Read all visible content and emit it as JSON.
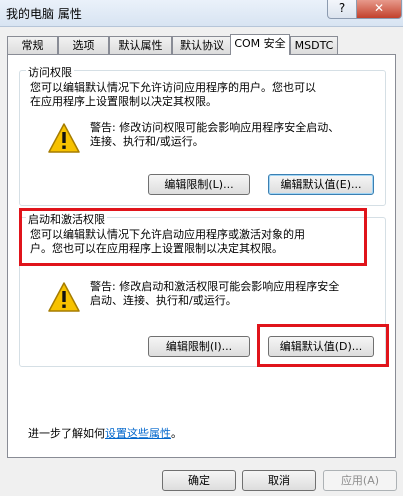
{
  "window": {
    "title": "我的电脑 属性",
    "help_label": "?",
    "close_label": "✕"
  },
  "tabs": [
    {
      "label": "常规"
    },
    {
      "label": "选项"
    },
    {
      "label": "默认属性"
    },
    {
      "label": "默认协议"
    },
    {
      "label": "COM 安全"
    },
    {
      "label": "MSDTC"
    }
  ],
  "access": {
    "title": "访问权限",
    "desc_line1": "您可以编辑默认情况下允许访问应用程序的用户。您也可以",
    "desc_line2": "在应用程序上设置限制以决定其权限。",
    "warning_line1": "警告: 修改访问权限可能会影响应用程序安全启动、",
    "warning_line2": "连接、执行和/或运行。",
    "edit_limits_label": "编辑限制(L)...",
    "edit_default_label": "编辑默认值(E)..."
  },
  "launch": {
    "title": "启动和激活权限",
    "desc_line1": "您可以编辑默认情况下允许启动应用程序或激活对象的用",
    "desc_line2": "户。您也可以在应用程序上设置限制以决定其权限。",
    "warning_line1": "警告: 修改启动和激活权限可能会影响应用程序安全",
    "warning_line2": "启动、连接、执行和/或运行。",
    "edit_limits_label": "编辑限制(I)...",
    "edit_default_label": "编辑默认值(D)..."
  },
  "learn_more": {
    "prefix": "进一步了解如何",
    "link": "设置这些属性",
    "suffix": "。"
  },
  "footer": {
    "ok_label": "确定",
    "cancel_label": "取消",
    "apply_label": "应用(A)"
  },
  "colors": {
    "highlight_box": "#e0141b",
    "link": "#0066cc"
  }
}
